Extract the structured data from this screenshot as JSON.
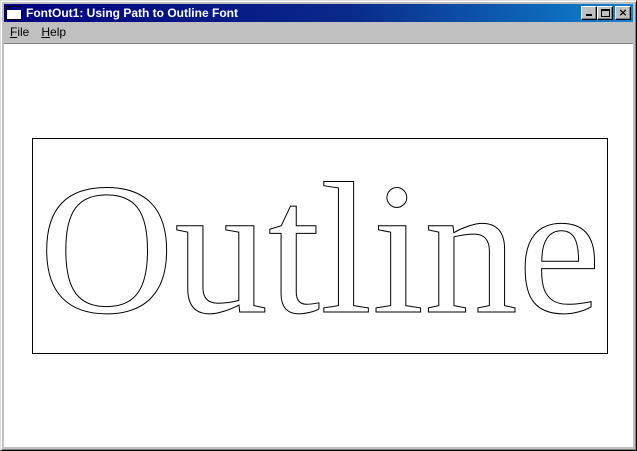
{
  "window": {
    "title": "FontOut1: Using Path to Outline Font",
    "controls": {
      "minimize": "minimize",
      "maximize": "maximize",
      "close": "×"
    }
  },
  "menu": {
    "file": {
      "accel": "F",
      "rest": "ile"
    },
    "help": {
      "accel": "H",
      "rest": "elp"
    }
  },
  "client": {
    "outline_text": "Outline"
  },
  "colors": {
    "titlebar_start": "#000080",
    "titlebar_end": "#1084d0",
    "face": "#c0c0c0",
    "client_bg": "#ffffff",
    "stroke": "#000000"
  },
  "icons": [
    "app-window-icon",
    "minimize-icon",
    "maximize-icon",
    "close-icon"
  ]
}
